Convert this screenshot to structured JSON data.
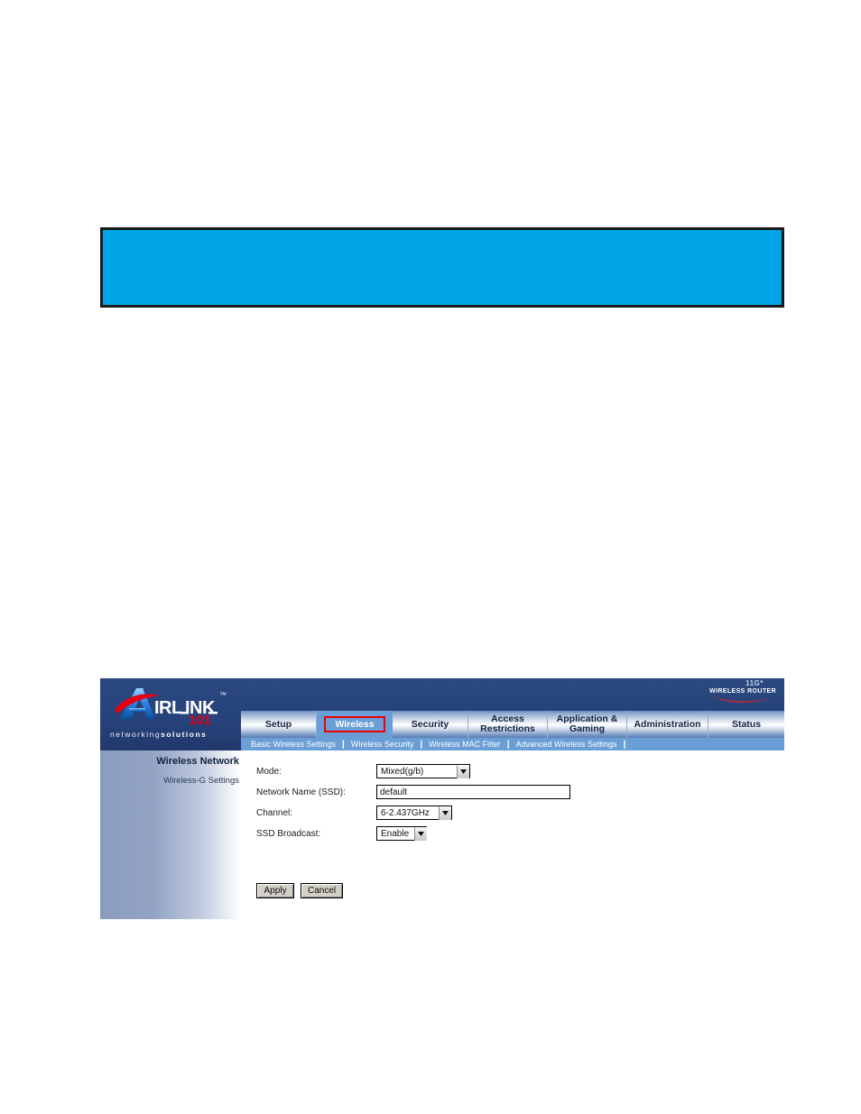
{
  "page": {
    "background_color": "#ffffff"
  },
  "callout": {
    "name": "blue-callout-box",
    "fill_color": "#00A5E8",
    "border_color": "#1a1a1a",
    "text": ""
  },
  "router_ui": {
    "brand": {
      "logo_text_air": "A",
      "logo_text_irlink": "IRLINK",
      "logo_tm": "™",
      "logo_101": "101",
      "tagline_light": "networking",
      "tagline_bold": "solutions",
      "accent_color": "#e60012",
      "logo_blue": "#0d63c4",
      "header_color": "#26427a"
    },
    "product_badge": {
      "model": "11G",
      "model_star": "*",
      "type": "WIRELESS ROUTER",
      "swoosh_color": "#cf2233"
    },
    "tabs": [
      {
        "label": "Setup",
        "name": "tab-setup",
        "active": false
      },
      {
        "label": "Wireless",
        "name": "tab-wireless",
        "active": true
      },
      {
        "label": "Security",
        "name": "tab-security",
        "active": false
      },
      {
        "label": "Access\nRestrictions",
        "name": "tab-access-restrictions",
        "active": false
      },
      {
        "label": "Application &\nGaming",
        "name": "tab-application-gaming",
        "active": false
      },
      {
        "label": "Administration",
        "name": "tab-administration",
        "active": false
      },
      {
        "label": "Status",
        "name": "tab-status",
        "active": false
      }
    ],
    "tab_labels": {
      "setup": "Setup",
      "wireless": "Wireless",
      "security": "Security",
      "access_line1": "Access",
      "access_line2": "Restrictions",
      "app_line1": "Application &",
      "app_line2": "Gaming",
      "administration": "Administration",
      "status": "Status"
    },
    "active_tab_highlight_color": "#ee0000",
    "subnav": {
      "items": [
        "Basic Wireless Settings",
        "Wireless Security",
        "Wireless MAC Filter",
        "Advanced Wireless Settings"
      ],
      "separator": "|",
      "background_color": "#6a9ed6"
    },
    "sidebar": {
      "title": "Wireless Network",
      "subtitle": "Wireless-G Settings"
    },
    "form": {
      "fields": [
        {
          "label": "Mode:",
          "control": "select",
          "value": "Mixed(g/b)",
          "name": "mode-select"
        },
        {
          "label": "Network Name (SSD):",
          "control": "text",
          "value": "default",
          "placeholder": "",
          "name": "network-name-input"
        },
        {
          "label": "Channel:",
          "control": "select",
          "value": "6-2.437GHz",
          "name": "channel-select"
        },
        {
          "label": "SSD Broadcast:",
          "control": "select",
          "value": "Enable",
          "name": "ssd-broadcast-select"
        }
      ],
      "labels": {
        "mode": "Mode:",
        "network_name": "Network Name (SSD):",
        "channel": "Channel:",
        "ssd_broadcast": "SSD Broadcast:"
      },
      "values": {
        "mode": "Mixed(g/b)",
        "network_name": "default",
        "channel": "6-2.437GHz",
        "ssd_broadcast": "Enable"
      }
    },
    "buttons": {
      "apply": "Apply",
      "cancel": "Cancel"
    }
  }
}
